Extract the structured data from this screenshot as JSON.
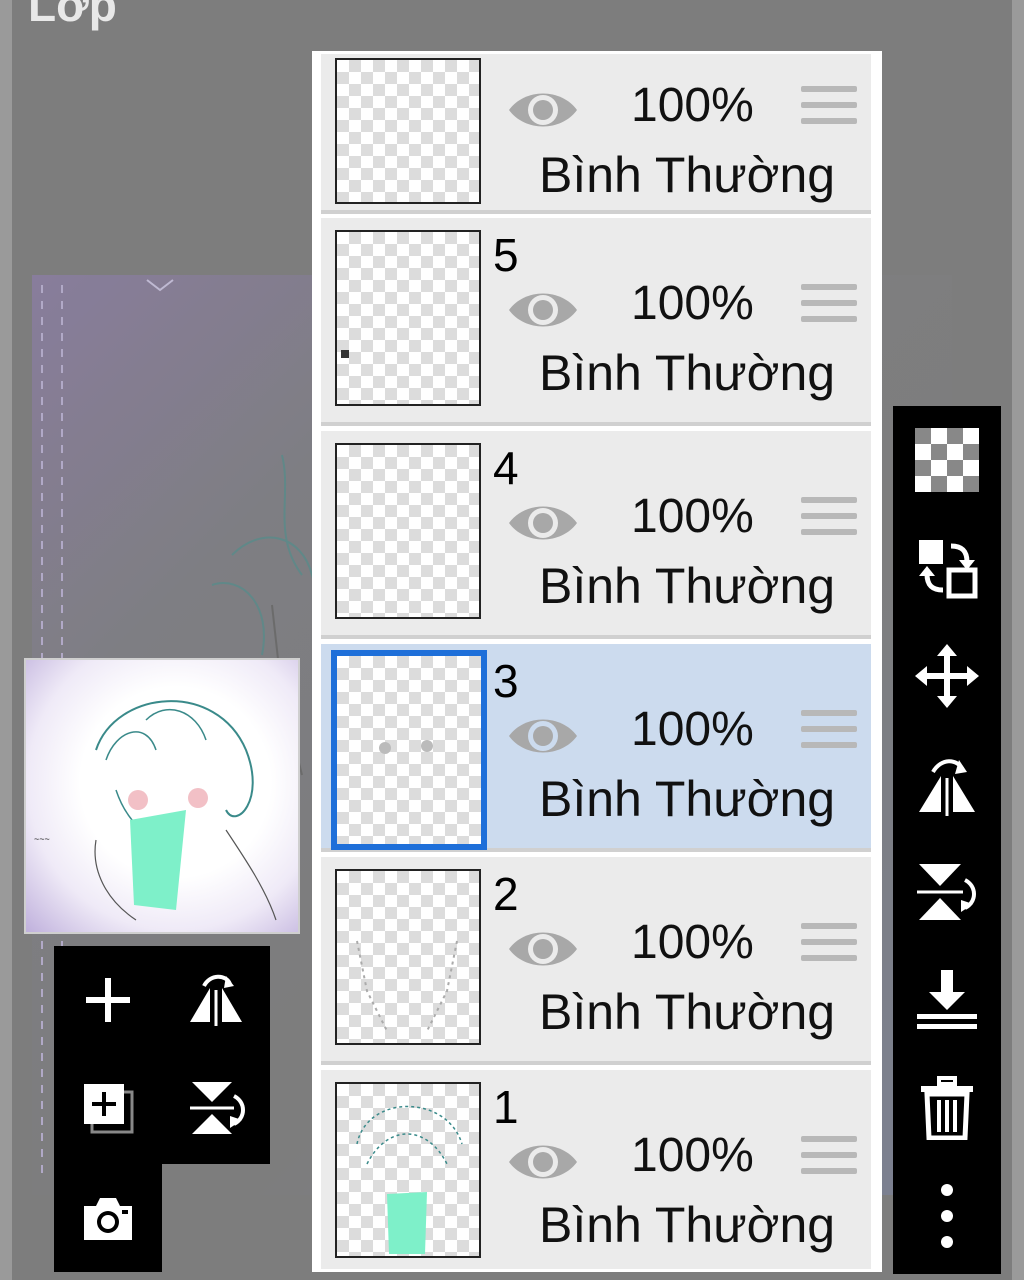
{
  "header": {
    "title": "Lớp"
  },
  "layers": [
    {
      "number": "",
      "opacity": "100%",
      "blend_mode": "Bình Thường",
      "selected": false
    },
    {
      "number": "5",
      "opacity": "100%",
      "blend_mode": "Bình Thường",
      "selected": false
    },
    {
      "number": "4",
      "opacity": "100%",
      "blend_mode": "Bình Thường",
      "selected": false
    },
    {
      "number": "3",
      "opacity": "100%",
      "blend_mode": "Bình Thường",
      "selected": true
    },
    {
      "number": "2",
      "opacity": "100%",
      "blend_mode": "Bình Thường",
      "selected": false
    },
    {
      "number": "1",
      "opacity": "100%",
      "blend_mode": "Bình Thường",
      "selected": false
    }
  ],
  "left_tools": [
    "add-layer-icon",
    "flip-horizontal-icon",
    "add-copy-layer-icon",
    "flip-vertical-icon",
    "camera-icon"
  ],
  "right_tools": [
    "transparency-icon",
    "swap-layer-icon",
    "move-icon",
    "flip-horizontal-icon",
    "flip-vertical-icon",
    "merge-down-icon",
    "trash-icon",
    "more-icon"
  ],
  "colors": {
    "selected_row": "#ccdbee",
    "selected_border": "#1e6fd9",
    "toolbar": "#000000"
  }
}
